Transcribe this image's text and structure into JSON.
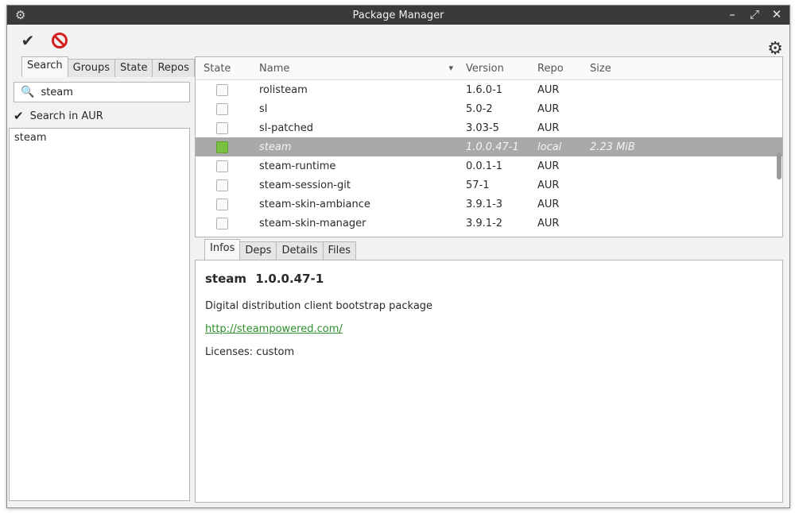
{
  "window": {
    "title": "Package Manager"
  },
  "left": {
    "tabs": [
      "Search",
      "Groups",
      "State",
      "Repos"
    ],
    "search_value": "steam",
    "search_in_aur_label": "Search in AUR",
    "results": [
      "steam"
    ]
  },
  "table": {
    "headers": {
      "state": "State",
      "name": "Name",
      "version": "Version",
      "repo": "Repo",
      "size": "Size"
    },
    "rows": [
      {
        "name": "rolisteam",
        "version": "1.6.0-1",
        "repo": "AUR",
        "size": ""
      },
      {
        "name": "sl",
        "version": "5.0-2",
        "repo": "AUR",
        "size": ""
      },
      {
        "name": "sl-patched",
        "version": "3.03-5",
        "repo": "AUR",
        "size": ""
      },
      {
        "name": "steam",
        "version": "1.0.0.47-1",
        "repo": "local",
        "size": "2.23 MiB"
      },
      {
        "name": "steam-runtime",
        "version": "0.0.1-1",
        "repo": "AUR",
        "size": ""
      },
      {
        "name": "steam-session-git",
        "version": "57-1",
        "repo": "AUR",
        "size": ""
      },
      {
        "name": "steam-skin-ambiance",
        "version": "3.9.1-3",
        "repo": "AUR",
        "size": ""
      },
      {
        "name": "steam-skin-manager",
        "version": "3.9.1-2",
        "repo": "AUR",
        "size": ""
      }
    ]
  },
  "details": {
    "tabs": [
      "Infos",
      "Deps",
      "Details",
      "Files"
    ],
    "name": "steam",
    "version": "1.0.0.47-1",
    "description": "Digital distribution client bootstrap package",
    "url": "http://steampowered.com/",
    "licenses": "Licenses: custom"
  },
  "colors": {
    "titlebar": "#3a3a3a",
    "selected_row": "#a9a9a9",
    "installed_checkbox": "#79c142",
    "link": "#2c8f2c",
    "cancel_icon": "#d42020"
  }
}
